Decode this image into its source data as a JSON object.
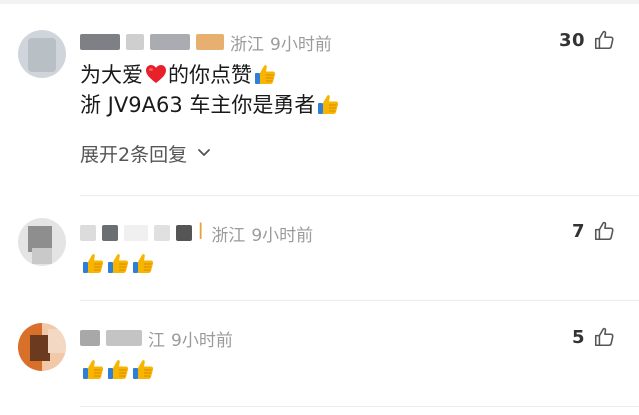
{
  "comments": [
    {
      "location": "浙江",
      "time": "9小时前",
      "likes": "30",
      "line1_a": "为大爱",
      "line1_b": "的你点赞",
      "line2": "浙 JV9A63 车主你是勇者",
      "expand_label": "展开2条回复"
    },
    {
      "location": "浙江",
      "time": "9小时前",
      "likes": "7"
    },
    {
      "location": "江",
      "time": "9小时前",
      "likes": "5"
    }
  ],
  "icons": {
    "like": "thumbs-up-outline-icon",
    "heart": "red-heart-emoji",
    "thumb_emoji": "thumbs-up-emoji",
    "expand": "chevron-down-icon"
  },
  "colors": {
    "meta_text": "#9b9b9b",
    "heart": "#e8202a",
    "thumb": "#f7b500"
  }
}
